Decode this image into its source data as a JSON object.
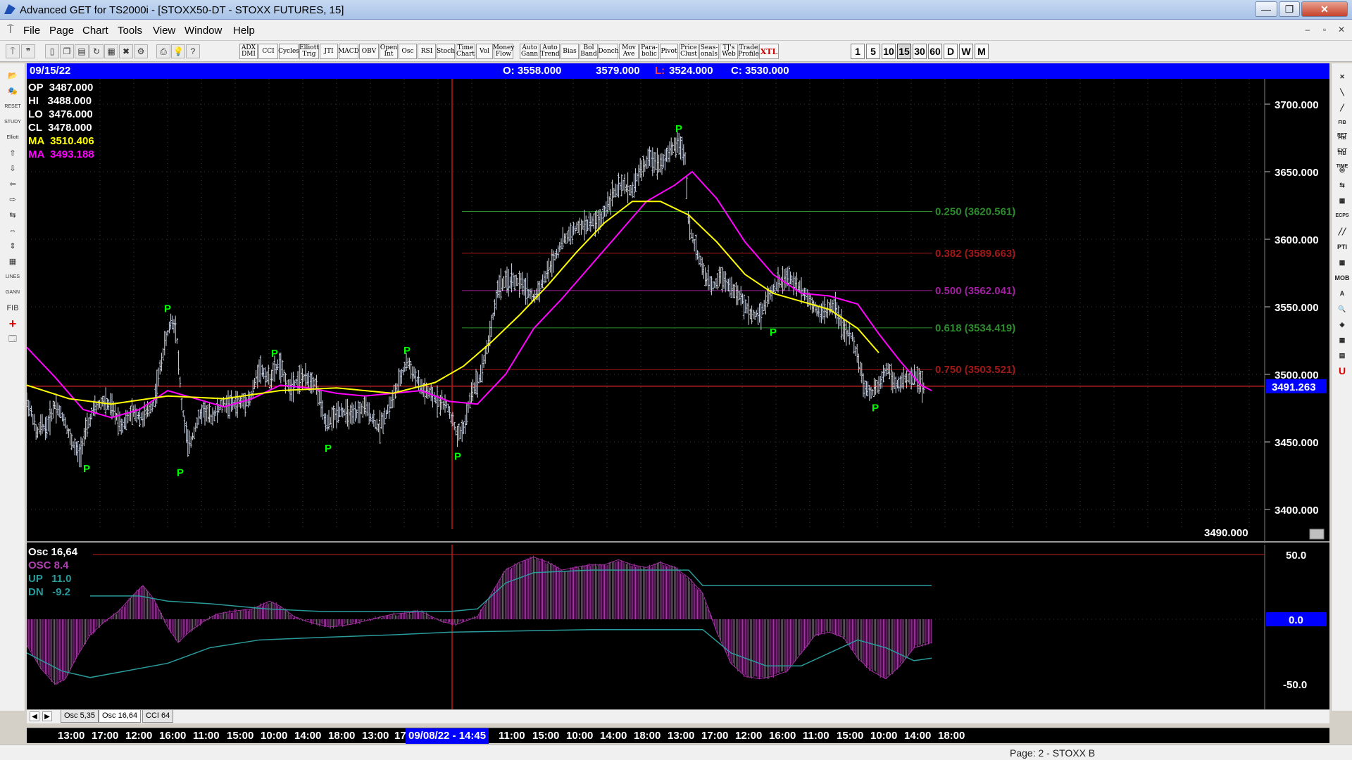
{
  "window": {
    "title": "Advanced GET for TS2000i - [STOXX50-DT - STOXX FUTURES, 15]",
    "buttons": [
      "—",
      "❐",
      "✕"
    ]
  },
  "menu": {
    "items": [
      "File",
      "Page",
      "Chart",
      "Tools",
      "View",
      "Window",
      "Help"
    ],
    "mdi_buttons": [
      "–",
      "▫",
      "✕"
    ]
  },
  "toolbar": {
    "indicators": [
      "ADX DMI",
      "CCI",
      "Cycles",
      "Elliott Trig",
      "JTI",
      "MACD",
      "OBV",
      "Open Int",
      "Osc",
      "RSI",
      "Stoch",
      "Time Chart",
      "Vol",
      "Money Flow",
      "Auto Gann",
      "Auto Trend",
      "Bias",
      "Bol Band",
      "Donch",
      "Mov Ave",
      "Para- bolic",
      "Pivot",
      "Price Clust",
      "Seas- onals",
      "TJ's Web",
      "Trade Profile",
      "XTL"
    ],
    "timeframes": [
      "1",
      "5",
      "10",
      "15",
      "30",
      "60",
      "D",
      "W",
      "M"
    ],
    "active_timeframe": "15"
  },
  "left_tools": [
    "📂",
    "🎭",
    "RESET",
    "STUDY",
    "Elliott",
    "⇧",
    "⇩",
    "⇦",
    "⇨",
    "⇆",
    "⇔",
    "⇕",
    "▦",
    "LINES",
    "GANN",
    "FIB",
    "+",
    "🗔"
  ],
  "right_tools": [
    "✕",
    "╲",
    "╱",
    "FIB RET",
    "FIB EXT",
    "FIB TIME",
    "◎",
    "⇆",
    "▦",
    "ECPS",
    "╱╱",
    "PTI",
    "▦",
    "MOB",
    "A",
    "🔍",
    "◈",
    "▦",
    "▤",
    "U"
  ],
  "infobar": {
    "date": "09/15/22",
    "open": "O: 3558.000",
    "high": "3579.000",
    "low_label": "L:",
    "low": "3524.000",
    "close": "C: 3530.000"
  },
  "legend": {
    "op": "OP  3487.000",
    "hi": "HI   3488.000",
    "lo": "LO  3476.000",
    "cl": "CL  3478.000",
    "ma1": "MA  3510.406",
    "ma2": "MA  3493.188"
  },
  "price_axis": {
    "ticks": [
      "3700.000",
      "3650.000",
      "3600.000",
      "3550.000",
      "3500.000",
      "3450.000",
      "3400.000"
    ],
    "current": "3491.263",
    "cursor_value": "3490.000"
  },
  "fib_levels": [
    {
      "label": "0.250 (3620.561)",
      "value": 3620.561,
      "color": "#2e8b2e"
    },
    {
      "label": "0.382 (3589.663)",
      "value": 3589.663,
      "color": "#a01818"
    },
    {
      "label": "0.500 (3562.041)",
      "value": 3562.041,
      "color": "#a020a0"
    },
    {
      "label": "0.618 (3534.419)",
      "value": 3534.419,
      "color": "#2e8b2e"
    },
    {
      "label": "0.750 (3503.521)",
      "value": 3503.521,
      "color": "#a01818"
    }
  ],
  "pivot_marker": "P",
  "osc_legend": {
    "title": "Osc 16,64",
    "osc": "OSC 8.4",
    "up": "UP   11.0",
    "dn": "DN   -9.2"
  },
  "osc_axis": {
    "ticks": [
      "50.0",
      "-50.0"
    ],
    "zero": "0.0"
  },
  "sheet_tabs": [
    "Osc 5,35",
    "Osc 16,64",
    "CCI 64"
  ],
  "active_sheet": "Osc 16,64",
  "time_axis": {
    "labels": [
      "13:00",
      "17:00",
      "12:00",
      "16:00",
      "11:00",
      "15:00",
      "10:00",
      "14:00",
      "18:00",
      "13:00",
      "17",
      "11:00",
      "15:00",
      "10:00",
      "14:00",
      "18:00",
      "13:00",
      "17:00",
      "12:00",
      "16:00",
      "11:00",
      "15:00",
      "10:00",
      "14:00",
      "18:00"
    ],
    "selected": "09/08/22 - 14:45"
  },
  "status": {
    "page": "Page: 2 - STOXX B"
  },
  "colors": {
    "bars": "#d0d8e8",
    "ma_fast": "#ffff00",
    "ma_slow": "#ff00ff",
    "pivot": "#00ff00",
    "osc_hist": "#b040b0",
    "osc_bands": "#2a9a9a",
    "infobar": "#0000ff"
  },
  "chart_data": {
    "type": "candlestick",
    "price_range": [
      3400,
      3700
    ],
    "osc_range": [
      -50,
      50
    ],
    "price_path": [
      [
        0,
        3480
      ],
      [
        8,
        3470
      ],
      [
        14,
        3455
      ],
      [
        20,
        3462
      ],
      [
        28,
        3460
      ],
      [
        40,
        3478
      ],
      [
        54,
        3466
      ],
      [
        62,
        3452
      ],
      [
        75,
        3440
      ],
      [
        82,
        3455
      ],
      [
        95,
        3474
      ],
      [
        108,
        3480
      ],
      [
        120,
        3476
      ],
      [
        135,
        3462
      ],
      [
        150,
        3472
      ],
      [
        165,
        3468
      ],
      [
        180,
        3478
      ],
      [
        195,
        3520
      ],
      [
        205,
        3540
      ],
      [
        212,
        3535
      ],
      [
        220,
        3478
      ],
      [
        230,
        3445
      ],
      [
        240,
        3462
      ],
      [
        250,
        3474
      ],
      [
        262,
        3468
      ],
      [
        278,
        3478
      ],
      [
        295,
        3478
      ],
      [
        318,
        3482
      ],
      [
        330,
        3505
      ],
      [
        345,
        3496
      ],
      [
        358,
        3508
      ],
      [
        372,
        3490
      ],
      [
        390,
        3498
      ],
      [
        410,
        3494
      ],
      [
        425,
        3462
      ],
      [
        445,
        3474
      ],
      [
        462,
        3468
      ],
      [
        480,
        3476
      ],
      [
        500,
        3460
      ],
      [
        520,
        3482
      ],
      [
        540,
        3510
      ],
      [
        560,
        3490
      ],
      [
        580,
        3482
      ],
      [
        598,
        3476
      ],
      [
        612,
        3454
      ],
      [
        622,
        3462
      ],
      [
        632,
        3488
      ],
      [
        642,
        3496
      ],
      [
        655,
        3522
      ],
      [
        670,
        3566
      ],
      [
        690,
        3570
      ],
      [
        705,
        3566
      ],
      [
        720,
        3556
      ],
      [
        740,
        3576
      ],
      [
        760,
        3598
      ],
      [
        780,
        3608
      ],
      [
        800,
        3612
      ],
      [
        815,
        3614
      ],
      [
        830,
        3632
      ],
      [
        845,
        3640
      ],
      [
        860,
        3636
      ],
      [
        870,
        3650
      ],
      [
        885,
        3660
      ],
      [
        900,
        3656
      ],
      [
        915,
        3666
      ],
      [
        926,
        3672
      ],
      [
        935,
        3660
      ],
      [
        940,
        3612
      ],
      [
        948,
        3596
      ],
      [
        955,
        3586
      ],
      [
        965,
        3570
      ],
      [
        975,
        3565
      ],
      [
        985,
        3574
      ],
      [
        1000,
        3564
      ],
      [
        1015,
        3556
      ],
      [
        1028,
        3544
      ],
      [
        1042,
        3545
      ],
      [
        1055,
        3560
      ],
      [
        1068,
        3568
      ],
      [
        1080,
        3572
      ],
      [
        1095,
        3566
      ],
      [
        1108,
        3558
      ],
      [
        1122,
        3548
      ],
      [
        1135,
        3546
      ],
      [
        1148,
        3552
      ],
      [
        1160,
        3532
      ],
      [
        1172,
        3528
      ],
      [
        1180,
        3512
      ],
      [
        1190,
        3490
      ],
      [
        1200,
        3486
      ],
      [
        1210,
        3492
      ],
      [
        1222,
        3505
      ],
      [
        1235,
        3492
      ],
      [
        1248,
        3496
      ],
      [
        1262,
        3500
      ],
      [
        1275,
        3488
      ]
    ],
    "ma_fast_path": [
      [
        0,
        3492
      ],
      [
        60,
        3482
      ],
      [
        120,
        3478
      ],
      [
        200,
        3484
      ],
      [
        280,
        3482
      ],
      [
        360,
        3488
      ],
      [
        440,
        3490
      ],
      [
        520,
        3486
      ],
      [
        580,
        3494
      ],
      [
        620,
        3506
      ],
      [
        660,
        3524
      ],
      [
        700,
        3544
      ],
      [
        740,
        3566
      ],
      [
        780,
        3590
      ],
      [
        820,
        3612
      ],
      [
        860,
        3628
      ],
      [
        900,
        3628
      ],
      [
        940,
        3618
      ],
      [
        980,
        3598
      ],
      [
        1020,
        3574
      ],
      [
        1060,
        3560
      ],
      [
        1100,
        3554
      ],
      [
        1140,
        3548
      ],
      [
        1180,
        3534
      ],
      [
        1210,
        3516
      ]
    ],
    "ma_slow_path": [
      [
        0,
        3520
      ],
      [
        40,
        3498
      ],
      [
        80,
        3474
      ],
      [
        120,
        3468
      ],
      [
        160,
        3474
      ],
      [
        200,
        3488
      ],
      [
        240,
        3482
      ],
      [
        280,
        3476
      ],
      [
        320,
        3482
      ],
      [
        360,
        3492
      ],
      [
        400,
        3490
      ],
      [
        440,
        3486
      ],
      [
        480,
        3484
      ],
      [
        520,
        3486
      ],
      [
        560,
        3488
      ],
      [
        600,
        3480
      ],
      [
        640,
        3478
      ],
      [
        680,
        3500
      ],
      [
        720,
        3534
      ],
      [
        760,
        3556
      ],
      [
        800,
        3580
      ],
      [
        840,
        3604
      ],
      [
        880,
        3628
      ],
      [
        920,
        3640
      ],
      [
        945,
        3650
      ],
      [
        980,
        3630
      ],
      [
        1020,
        3598
      ],
      [
        1060,
        3574
      ],
      [
        1100,
        3560
      ],
      [
        1140,
        3558
      ],
      [
        1180,
        3552
      ],
      [
        1210,
        3530
      ],
      [
        1240,
        3510
      ],
      [
        1270,
        3492
      ],
      [
        1285,
        3488
      ]
    ],
    "pivots": [
      {
        "bar": 85,
        "value": 3435,
        "pos": "below"
      },
      {
        "bar": 200,
        "value": 3545,
        "pos": "above"
      },
      {
        "bar": 218,
        "value": 3432,
        "pos": "below"
      },
      {
        "bar": 352,
        "value": 3512,
        "pos": "above"
      },
      {
        "bar": 428,
        "value": 3450,
        "pos": "below"
      },
      {
        "bar": 540,
        "value": 3514,
        "pos": "above"
      },
      {
        "bar": 612,
        "value": 3444,
        "pos": "below"
      },
      {
        "bar": 926,
        "value": 3678,
        "pos": "above"
      },
      {
        "bar": 1060,
        "value": 3536,
        "pos": "below"
      },
      {
        "bar": 1205,
        "value": 3480,
        "pos": "below"
      }
    ],
    "osc_path": [
      [
        0,
        -20
      ],
      [
        20,
        -38
      ],
      [
        40,
        -50
      ],
      [
        55,
        -46
      ],
      [
        70,
        -30
      ],
      [
        90,
        -12
      ],
      [
        110,
        -2
      ],
      [
        130,
        6
      ],
      [
        150,
        18
      ],
      [
        165,
        26
      ],
      [
        180,
        16
      ],
      [
        200,
        -6
      ],
      [
        215,
        -18
      ],
      [
        230,
        -10
      ],
      [
        250,
        -2
      ],
      [
        270,
        4
      ],
      [
        290,
        6
      ],
      [
        320,
        8
      ],
      [
        345,
        14
      ],
      [
        360,
        10
      ],
      [
        380,
        2
      ],
      [
        400,
        -2
      ],
      [
        430,
        -6
      ],
      [
        460,
        -4
      ],
      [
        490,
        0
      ],
      [
        520,
        4
      ],
      [
        560,
        6
      ],
      [
        590,
        -2
      ],
      [
        610,
        -4
      ],
      [
        640,
        2
      ],
      [
        660,
        20
      ],
      [
        680,
        38
      ],
      [
        700,
        44
      ],
      [
        720,
        48
      ],
      [
        740,
        44
      ],
      [
        760,
        38
      ],
      [
        780,
        40
      ],
      [
        800,
        42
      ],
      [
        820,
        42
      ],
      [
        840,
        46
      ],
      [
        860,
        42
      ],
      [
        880,
        40
      ],
      [
        900,
        44
      ],
      [
        920,
        40
      ],
      [
        940,
        32
      ],
      [
        960,
        20
      ],
      [
        980,
        -10
      ],
      [
        1000,
        -34
      ],
      [
        1020,
        -44
      ],
      [
        1040,
        -46
      ],
      [
        1060,
        -44
      ],
      [
        1080,
        -40
      ],
      [
        1100,
        -26
      ],
      [
        1120,
        -12
      ],
      [
        1140,
        -10
      ],
      [
        1160,
        -14
      ],
      [
        1180,
        -30
      ],
      [
        1200,
        -40
      ],
      [
        1220,
        -46
      ],
      [
        1240,
        -36
      ],
      [
        1260,
        -22
      ],
      [
        1285,
        -18
      ]
    ],
    "up_band_path": [
      [
        90,
        18
      ],
      [
        160,
        18
      ],
      [
        200,
        14
      ],
      [
        260,
        12
      ],
      [
        340,
        8
      ],
      [
        420,
        6
      ],
      [
        520,
        6
      ],
      [
        600,
        6
      ],
      [
        640,
        8
      ],
      [
        680,
        28
      ],
      [
        720,
        36
      ],
      [
        800,
        38
      ],
      [
        880,
        38
      ],
      [
        940,
        38
      ],
      [
        960,
        26
      ],
      [
        1285,
        26
      ]
    ],
    "dn_band_path": [
      [
        0,
        -26
      ],
      [
        50,
        -40
      ],
      [
        90,
        -45
      ],
      [
        140,
        -40
      ],
      [
        200,
        -34
      ],
      [
        260,
        -22
      ],
      [
        330,
        -16
      ],
      [
        420,
        -14
      ],
      [
        520,
        -12
      ],
      [
        600,
        -10
      ],
      [
        800,
        -8
      ],
      [
        960,
        -8
      ],
      [
        1000,
        -26
      ],
      [
        1050,
        -36
      ],
      [
        1100,
        -36
      ],
      [
        1140,
        -26
      ],
      [
        1180,
        -16
      ],
      [
        1220,
        -22
      ],
      [
        1260,
        -32
      ],
      [
        1285,
        -30
      ]
    ]
  }
}
